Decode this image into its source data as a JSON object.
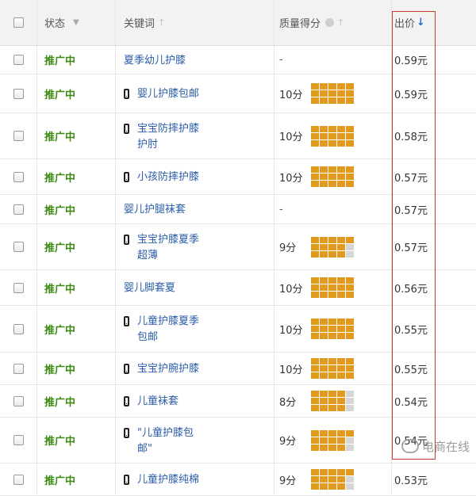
{
  "header": {
    "status": "状态",
    "keyword": "关键词",
    "quality": "质量得分",
    "price": "出价"
  },
  "rows": [
    {
      "status": "推广中",
      "mobile": false,
      "keyword": [
        "夏季幼儿护膝"
      ],
      "score": "-",
      "bars": null,
      "price": "0.59元"
    },
    {
      "status": "推广中",
      "mobile": true,
      "keyword": [
        "婴儿护膝包邮"
      ],
      "score": "10分",
      "bars": 10,
      "price": "0.59元"
    },
    {
      "status": "推广中",
      "mobile": true,
      "keyword": [
        "宝宝防摔护膝",
        "护肘"
      ],
      "score": "10分",
      "bars": 10,
      "price": "0.58元"
    },
    {
      "status": "推广中",
      "mobile": true,
      "keyword": [
        "小孩防摔护膝"
      ],
      "score": "10分",
      "bars": 10,
      "price": "0.57元"
    },
    {
      "status": "推广中",
      "mobile": false,
      "keyword": [
        "婴儿护腿袜套"
      ],
      "score": "-",
      "bars": null,
      "price": "0.57元"
    },
    {
      "status": "推广中",
      "mobile": true,
      "keyword": [
        "宝宝护膝夏季",
        "超薄"
      ],
      "score": "9分",
      "bars": 9,
      "price": "0.57元"
    },
    {
      "status": "推广中",
      "mobile": false,
      "keyword": [
        "婴儿脚套夏"
      ],
      "score": "10分",
      "bars": 10,
      "price": "0.56元"
    },
    {
      "status": "推广中",
      "mobile": true,
      "keyword": [
        "儿童护膝夏季",
        "包邮"
      ],
      "score": "10分",
      "bars": 10,
      "price": "0.55元"
    },
    {
      "status": "推广中",
      "mobile": true,
      "keyword": [
        "宝宝护腕护膝"
      ],
      "score": "10分",
      "bars": 10,
      "price": "0.55元"
    },
    {
      "status": "推广中",
      "mobile": true,
      "keyword": [
        "儿童袜套"
      ],
      "score": "8分",
      "bars": 8,
      "price": "0.54元"
    },
    {
      "status": "推广中",
      "mobile": true,
      "keyword": [
        "\"儿童护膝包",
        "邮\""
      ],
      "score": "9分",
      "bars": 9,
      "price": "0.54元"
    },
    {
      "status": "推广中",
      "mobile": true,
      "keyword": [
        "儿童护膝纯棉"
      ],
      "score": "9分",
      "bars": 9,
      "price": "0.53元"
    }
  ],
  "watermark": "电商在线",
  "colors": {
    "status_green": "#3b8a12",
    "keyword_blue": "#2a5ca8",
    "bar_orange": "#e09a1f",
    "bar_off": "#d6d6d6",
    "highlight_red": "#c0392b"
  }
}
